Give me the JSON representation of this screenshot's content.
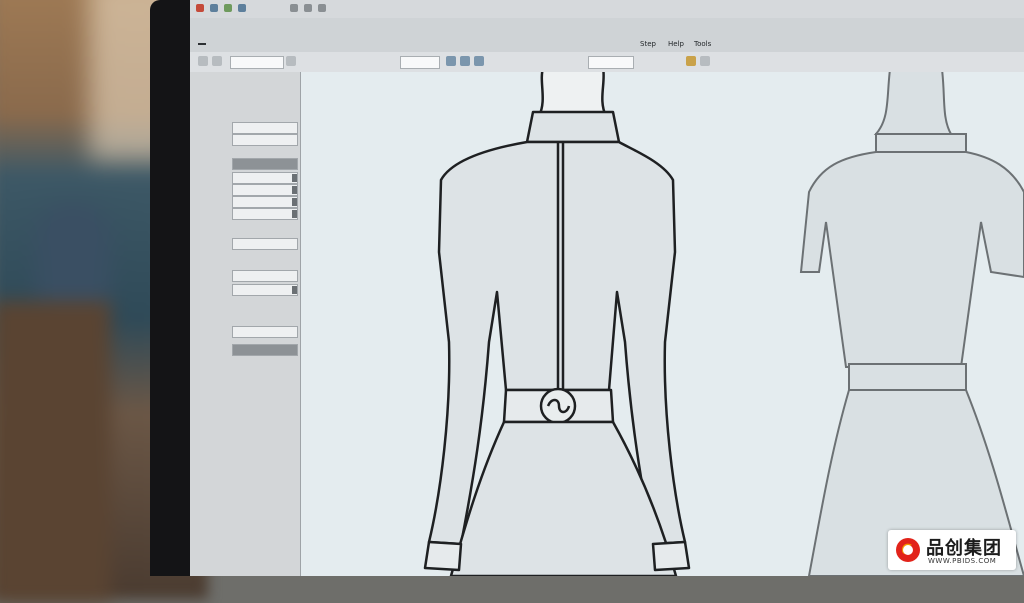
{
  "app": {
    "name": "",
    "ribbon_tabs": [
      "Step",
      "Help",
      "Tools"
    ],
    "active_tab": ""
  },
  "toolbar": {
    "fields": [
      "",
      "",
      ""
    ]
  },
  "panel": {
    "rows": [
      {
        "label": "",
        "value": ""
      },
      {
        "label": "",
        "value": ""
      },
      {
        "label": "",
        "value": ""
      },
      {
        "label": "",
        "value": ""
      },
      {
        "label": "",
        "value": ""
      },
      {
        "label": "",
        "value": ""
      },
      {
        "label": "",
        "value": ""
      },
      {
        "label": "",
        "value": ""
      },
      {
        "label": "",
        "value": ""
      },
      {
        "label": "",
        "value": ""
      },
      {
        "label": "",
        "value": ""
      },
      {
        "label": "",
        "value": ""
      },
      {
        "label": "",
        "value": ""
      }
    ]
  },
  "watermark": {
    "name": "品创集团",
    "site": "WWW.PBIDS.COM"
  },
  "colors": {
    "screen_bg": "#e4ecef",
    "bezel": "#141416",
    "panel_bg": "#d3d6d8",
    "watermark_red": "#e2231a",
    "watermark_orange": "#f39800"
  }
}
